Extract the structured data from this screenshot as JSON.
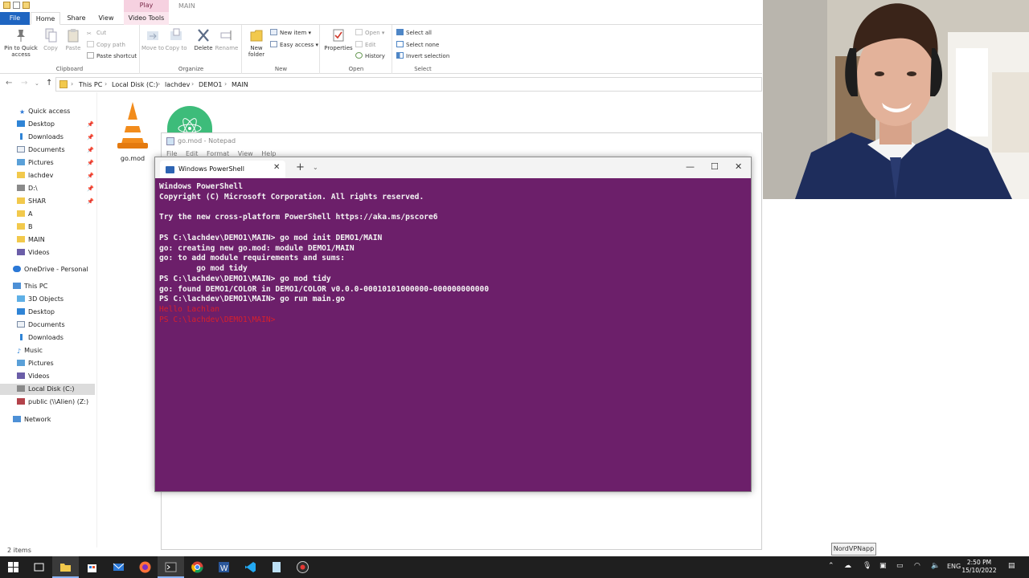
{
  "explorer": {
    "window_title": "MAIN",
    "contextual_tab": "Play",
    "tabs": [
      "File",
      "Home",
      "Share",
      "View",
      "Video Tools"
    ],
    "ribbon": {
      "clipboard": {
        "label": "Clipboard",
        "pin": "Pin to Quick access",
        "copy": "Copy",
        "paste": "Paste",
        "cut": "Cut",
        "copy_path": "Copy path",
        "paste_shortcut": "Paste shortcut"
      },
      "organize": {
        "label": "Organize",
        "move_to": "Move to",
        "copy_to": "Copy to",
        "delete": "Delete",
        "rename": "Rename"
      },
      "new": {
        "label": "New",
        "new_folder": "New folder",
        "new_item": "New item",
        "easy_access": "Easy access"
      },
      "open": {
        "label": "Open",
        "properties": "Properties",
        "open": "Open",
        "edit": "Edit",
        "history": "History"
      },
      "select": {
        "label": "Select",
        "select_all": "Select all",
        "select_none": "Select none",
        "invert": "Invert selection"
      }
    },
    "breadcrumb": [
      "This PC",
      "Local Disk (C:)",
      "lachdev",
      "DEMO1",
      "MAIN"
    ],
    "sidebar": {
      "quick_access": "Quick access",
      "quick_items": [
        "Desktop",
        "Downloads",
        "Documents",
        "Pictures",
        "lachdev",
        "D:\\",
        "SHAR",
        "A",
        "B",
        "MAIN",
        "Videos"
      ],
      "onedrive": "OneDrive - Personal",
      "this_pc": "This PC",
      "pc_items": [
        "3D Objects",
        "Desktop",
        "Documents",
        "Downloads",
        "Music",
        "Pictures",
        "Videos",
        "Local Disk (C:)",
        "public (\\\\Alien) (Z:)"
      ],
      "network": "Network"
    },
    "files": [
      {
        "name": "go.mod"
      }
    ],
    "status": "2 items"
  },
  "notepad": {
    "title": "go.mod - Notepad",
    "menu": [
      "File",
      "Edit",
      "Format",
      "View",
      "Help"
    ]
  },
  "powershell": {
    "tab_title": "Windows PowerShell",
    "lines": [
      "Windows PowerShell",
      "Copyright (C) Microsoft Corporation. All rights reserved.",
      "",
      "Try the new cross-platform PowerShell https://aka.ms/pscore6",
      "",
      "PS C:\\lachdev\\DEMO1\\MAIN> go mod init DEMO1/MAIN",
      "go: creating new go.mod: module DEMO1/MAIN",
      "go: to add module requirements and sums:",
      "        go mod tidy",
      "PS C:\\lachdev\\DEMO1\\MAIN> go mod tidy",
      "go: found DEMO1/COLOR in DEMO1/COLOR v0.0.0-00010101000000-000000000000",
      "PS C:\\lachdev\\DEMO1\\MAIN> go run main.go"
    ],
    "error_lines": [
      "Hello Lachlan",
      "PS C:\\lachdev\\DEMO1\\MAIN>"
    ],
    "bg_color": "#6c1f6a",
    "error_color": "#d6202d"
  },
  "tooltip": "NordVPNapp",
  "taskbar": {
    "language": "ENG",
    "time": "2:50 PM",
    "date": "15/10/2022"
  }
}
